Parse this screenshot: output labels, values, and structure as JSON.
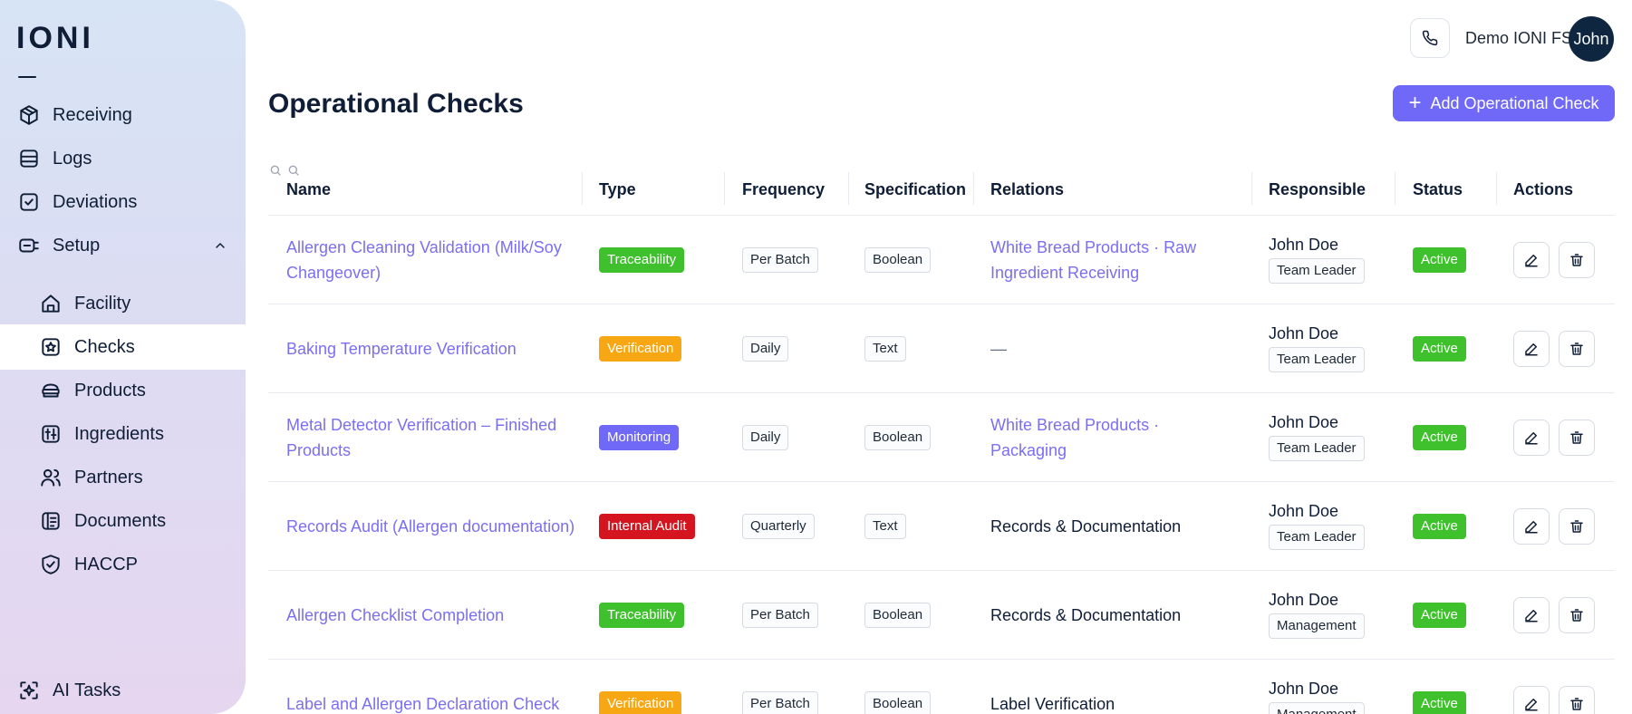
{
  "app": {
    "logo": "IONI"
  },
  "sidebar": {
    "items": [
      {
        "label": "Receiving",
        "icon": "package-icon"
      },
      {
        "label": "Logs",
        "icon": "database-icon"
      },
      {
        "label": "Deviations",
        "icon": "clipboard-check-icon"
      },
      {
        "label": "Setup",
        "icon": "wrench-icon",
        "expanded": true
      }
    ],
    "setup_items": [
      {
        "label": "Facility",
        "icon": "home-icon"
      },
      {
        "label": "Checks",
        "icon": "star-square-icon",
        "active": true
      },
      {
        "label": "Products",
        "icon": "bread-icon"
      },
      {
        "label": "Ingredients",
        "icon": "ingredients-icon"
      },
      {
        "label": "Partners",
        "icon": "users-icon"
      },
      {
        "label": "Documents",
        "icon": "document-icon"
      },
      {
        "label": "HACCP",
        "icon": "shield-icon"
      }
    ],
    "ai_tasks": {
      "label": "AI Tasks",
      "icon": "ai-sparkle-icon"
    }
  },
  "header": {
    "org_name": "Demo IONI FS",
    "avatar_text": "John",
    "phone_icon": "phone-icon"
  },
  "page": {
    "title": "Operational Checks",
    "add_button": "Add Operational Check"
  },
  "table": {
    "columns": [
      "Name",
      "Type",
      "Frequency",
      "Specification",
      "Relations",
      "Responsible",
      "Status",
      "Actions"
    ],
    "rows": [
      {
        "name": "Allergen Cleaning Validation (Milk/Soy Changeover)",
        "type": "Traceability",
        "frequency": "Per Batch",
        "specification": "Boolean",
        "relations": {
          "kind": "links",
          "items": [
            "White Bread Products",
            "Raw Ingredient Receiving"
          ]
        },
        "responsible": {
          "name": "John Doe",
          "role": "Team Leader"
        },
        "status": "Active"
      },
      {
        "name": "Baking Temperature Verification",
        "type": "Verification",
        "frequency": "Daily",
        "specification": "Text",
        "relations": {
          "kind": "none",
          "text": "—"
        },
        "responsible": {
          "name": "John Doe",
          "role": "Team Leader"
        },
        "status": "Active"
      },
      {
        "name": "Metal Detector Verification – Finished Products",
        "type": "Monitoring",
        "frequency": "Daily",
        "specification": "Boolean",
        "relations": {
          "kind": "links",
          "items": [
            "White Bread Products",
            "Packaging"
          ]
        },
        "responsible": {
          "name": "John Doe",
          "role": "Team Leader"
        },
        "status": "Active"
      },
      {
        "name": "Records Audit (Allergen documentation)",
        "type": "Internal Audit",
        "frequency": "Quarterly",
        "specification": "Text",
        "relations": {
          "kind": "text",
          "text": "Records & Documentation"
        },
        "responsible": {
          "name": "John Doe",
          "role": "Team Leader"
        },
        "status": "Active"
      },
      {
        "name": "Allergen Checklist Completion",
        "type": "Traceability",
        "frequency": "Per Batch",
        "specification": "Boolean",
        "relations": {
          "kind": "text",
          "text": "Records & Documentation"
        },
        "responsible": {
          "name": "John Doe",
          "role": "Management"
        },
        "status": "Active"
      },
      {
        "name": "Label and Allergen Declaration Check",
        "type": "Verification",
        "frequency": "Per Batch",
        "specification": "Boolean",
        "relations": {
          "kind": "text",
          "text": "Label Verification"
        },
        "responsible": {
          "name": "John Doe",
          "role": "Management"
        },
        "status": "Active"
      }
    ]
  },
  "colors": {
    "accent": "#7068f7",
    "link": "#7a6ff0",
    "type_traceability": "#3fc12e",
    "type_verification": "#f7a614",
    "type_monitoring": "#7068f7",
    "type_internal_audit": "#d4151f",
    "status_active": "#3fc12e"
  }
}
